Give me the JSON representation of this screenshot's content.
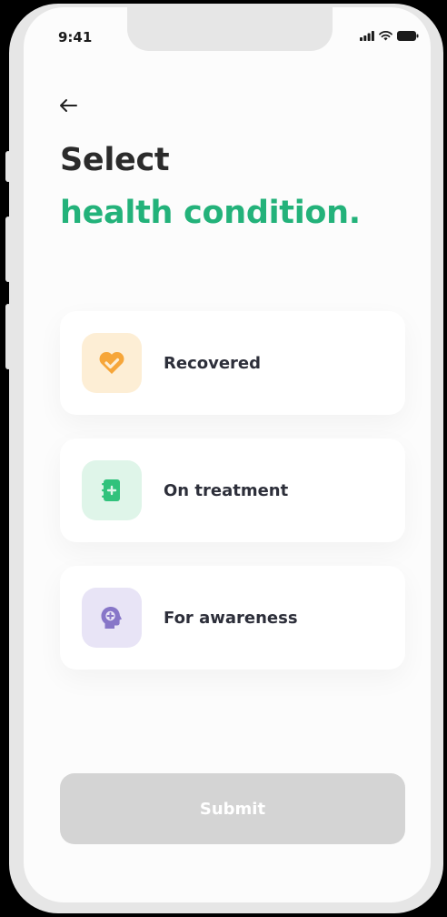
{
  "status_bar": {
    "time": "9:41"
  },
  "header": {
    "back_icon": "arrow-left-icon",
    "title_line1": "Select",
    "title_line2": "health condition."
  },
  "options": [
    {
      "label": "Recovered",
      "icon": "heart-check-icon",
      "tile_color": "#fdeed5",
      "icon_color": "#f6a63a"
    },
    {
      "label": "On treatment",
      "icon": "medical-book-icon",
      "tile_color": "#dff5e9",
      "icon_color": "#31c27c"
    },
    {
      "label": "For awareness",
      "icon": "head-plus-icon",
      "tile_color": "#e8e4f6",
      "icon_color": "#8776c8"
    }
  ],
  "footer": {
    "submit_label": "Submit"
  },
  "colors": {
    "accent": "#23b27a",
    "title_dark": "#2b2b2b",
    "submit_disabled": "#d4d4d4",
    "background": "#fcfcfc"
  }
}
